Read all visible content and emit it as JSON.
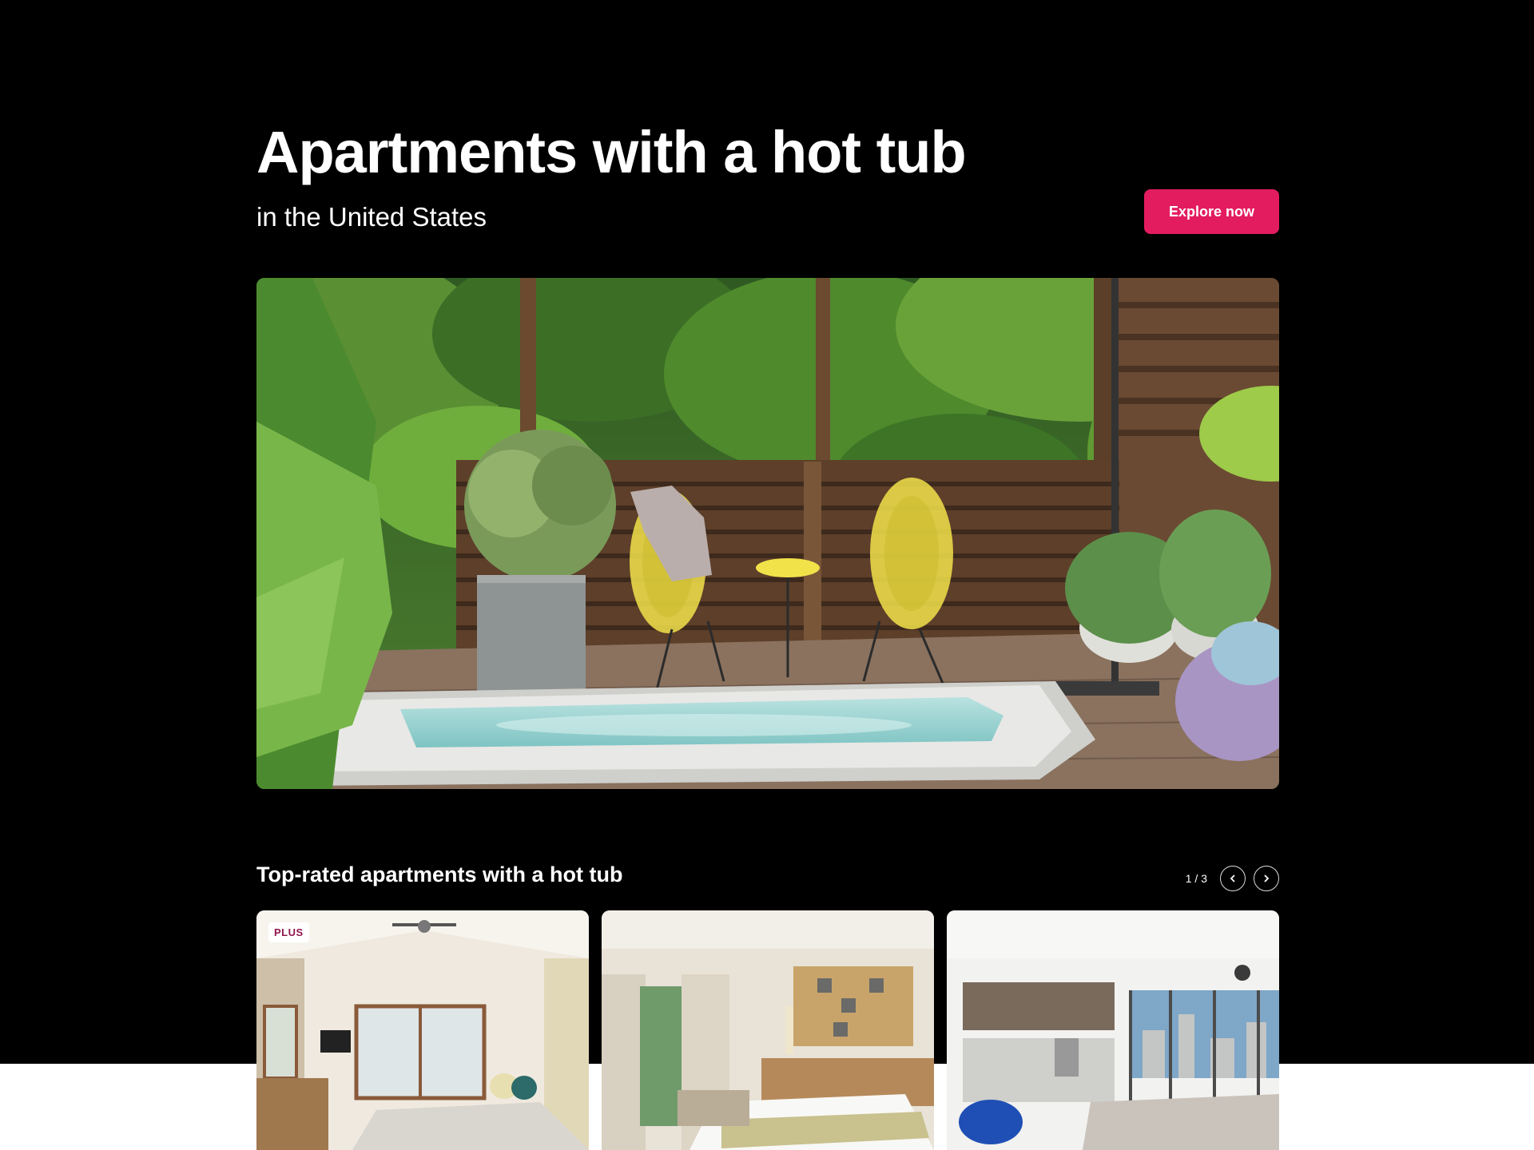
{
  "hero": {
    "title": "Apartments with a hot tub",
    "subtitle": "in the United States",
    "cta_label": "Explore now",
    "image_icon": "patio-hot-tub-photo"
  },
  "section": {
    "title": "Top-rated apartments with a hot tub",
    "pager_text": "1 / 3",
    "prev_icon": "chevron-left-icon",
    "next_icon": "chevron-right-icon"
  },
  "cards": [
    {
      "badge": "PLUS",
      "image_icon": "bedroom-photo"
    },
    {
      "image_icon": "hotel-room-photo"
    },
    {
      "image_icon": "living-room-city-view-photo"
    }
  ],
  "colors": {
    "background": "#000000",
    "accent": "#e31c5f",
    "text": "#ffffff",
    "plus_badge_text": "#92174d"
  }
}
